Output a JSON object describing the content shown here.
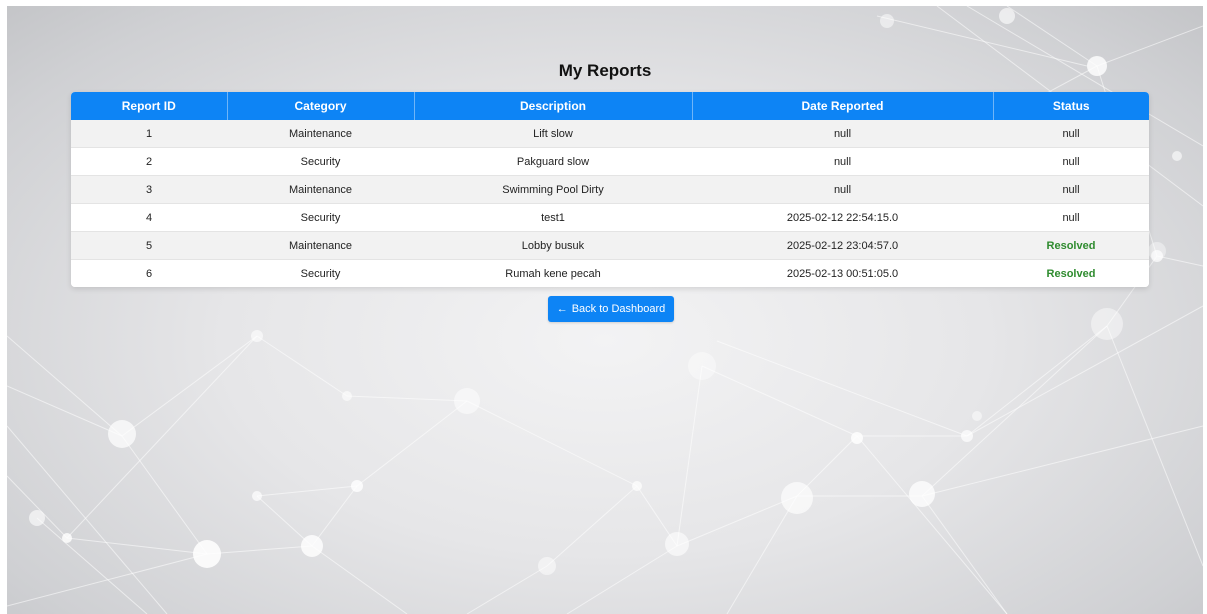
{
  "page": {
    "title": "My Reports"
  },
  "table": {
    "headers": [
      "Report ID",
      "Category",
      "Description",
      "Date Reported",
      "Status"
    ],
    "rows": [
      {
        "id": "1",
        "category": "Maintenance",
        "description": "Lift slow",
        "date": "null",
        "status": "null"
      },
      {
        "id": "2",
        "category": "Security",
        "description": "Pakguard slow",
        "date": "null",
        "status": "null"
      },
      {
        "id": "3",
        "category": "Maintenance",
        "description": "Swimming Pool Dirty",
        "date": "null",
        "status": "null"
      },
      {
        "id": "4",
        "category": "Security",
        "description": "test1",
        "date": "2025-02-12 22:54:15.0",
        "status": "null"
      },
      {
        "id": "5",
        "category": "Maintenance",
        "description": "Lobby busuk",
        "date": "2025-02-12 23:04:57.0",
        "status": "Resolved"
      },
      {
        "id": "6",
        "category": "Security",
        "description": "Rumah kene pecah",
        "date": "2025-02-13 00:51:05.0",
        "status": "Resolved"
      }
    ]
  },
  "actions": {
    "back_label": "Back to Dashboard",
    "back_icon": "arrow-left-icon"
  },
  "colors": {
    "accent": "#0d84f5",
    "resolved": "#2e8b2e",
    "row_alt": "#f2f2f2"
  }
}
